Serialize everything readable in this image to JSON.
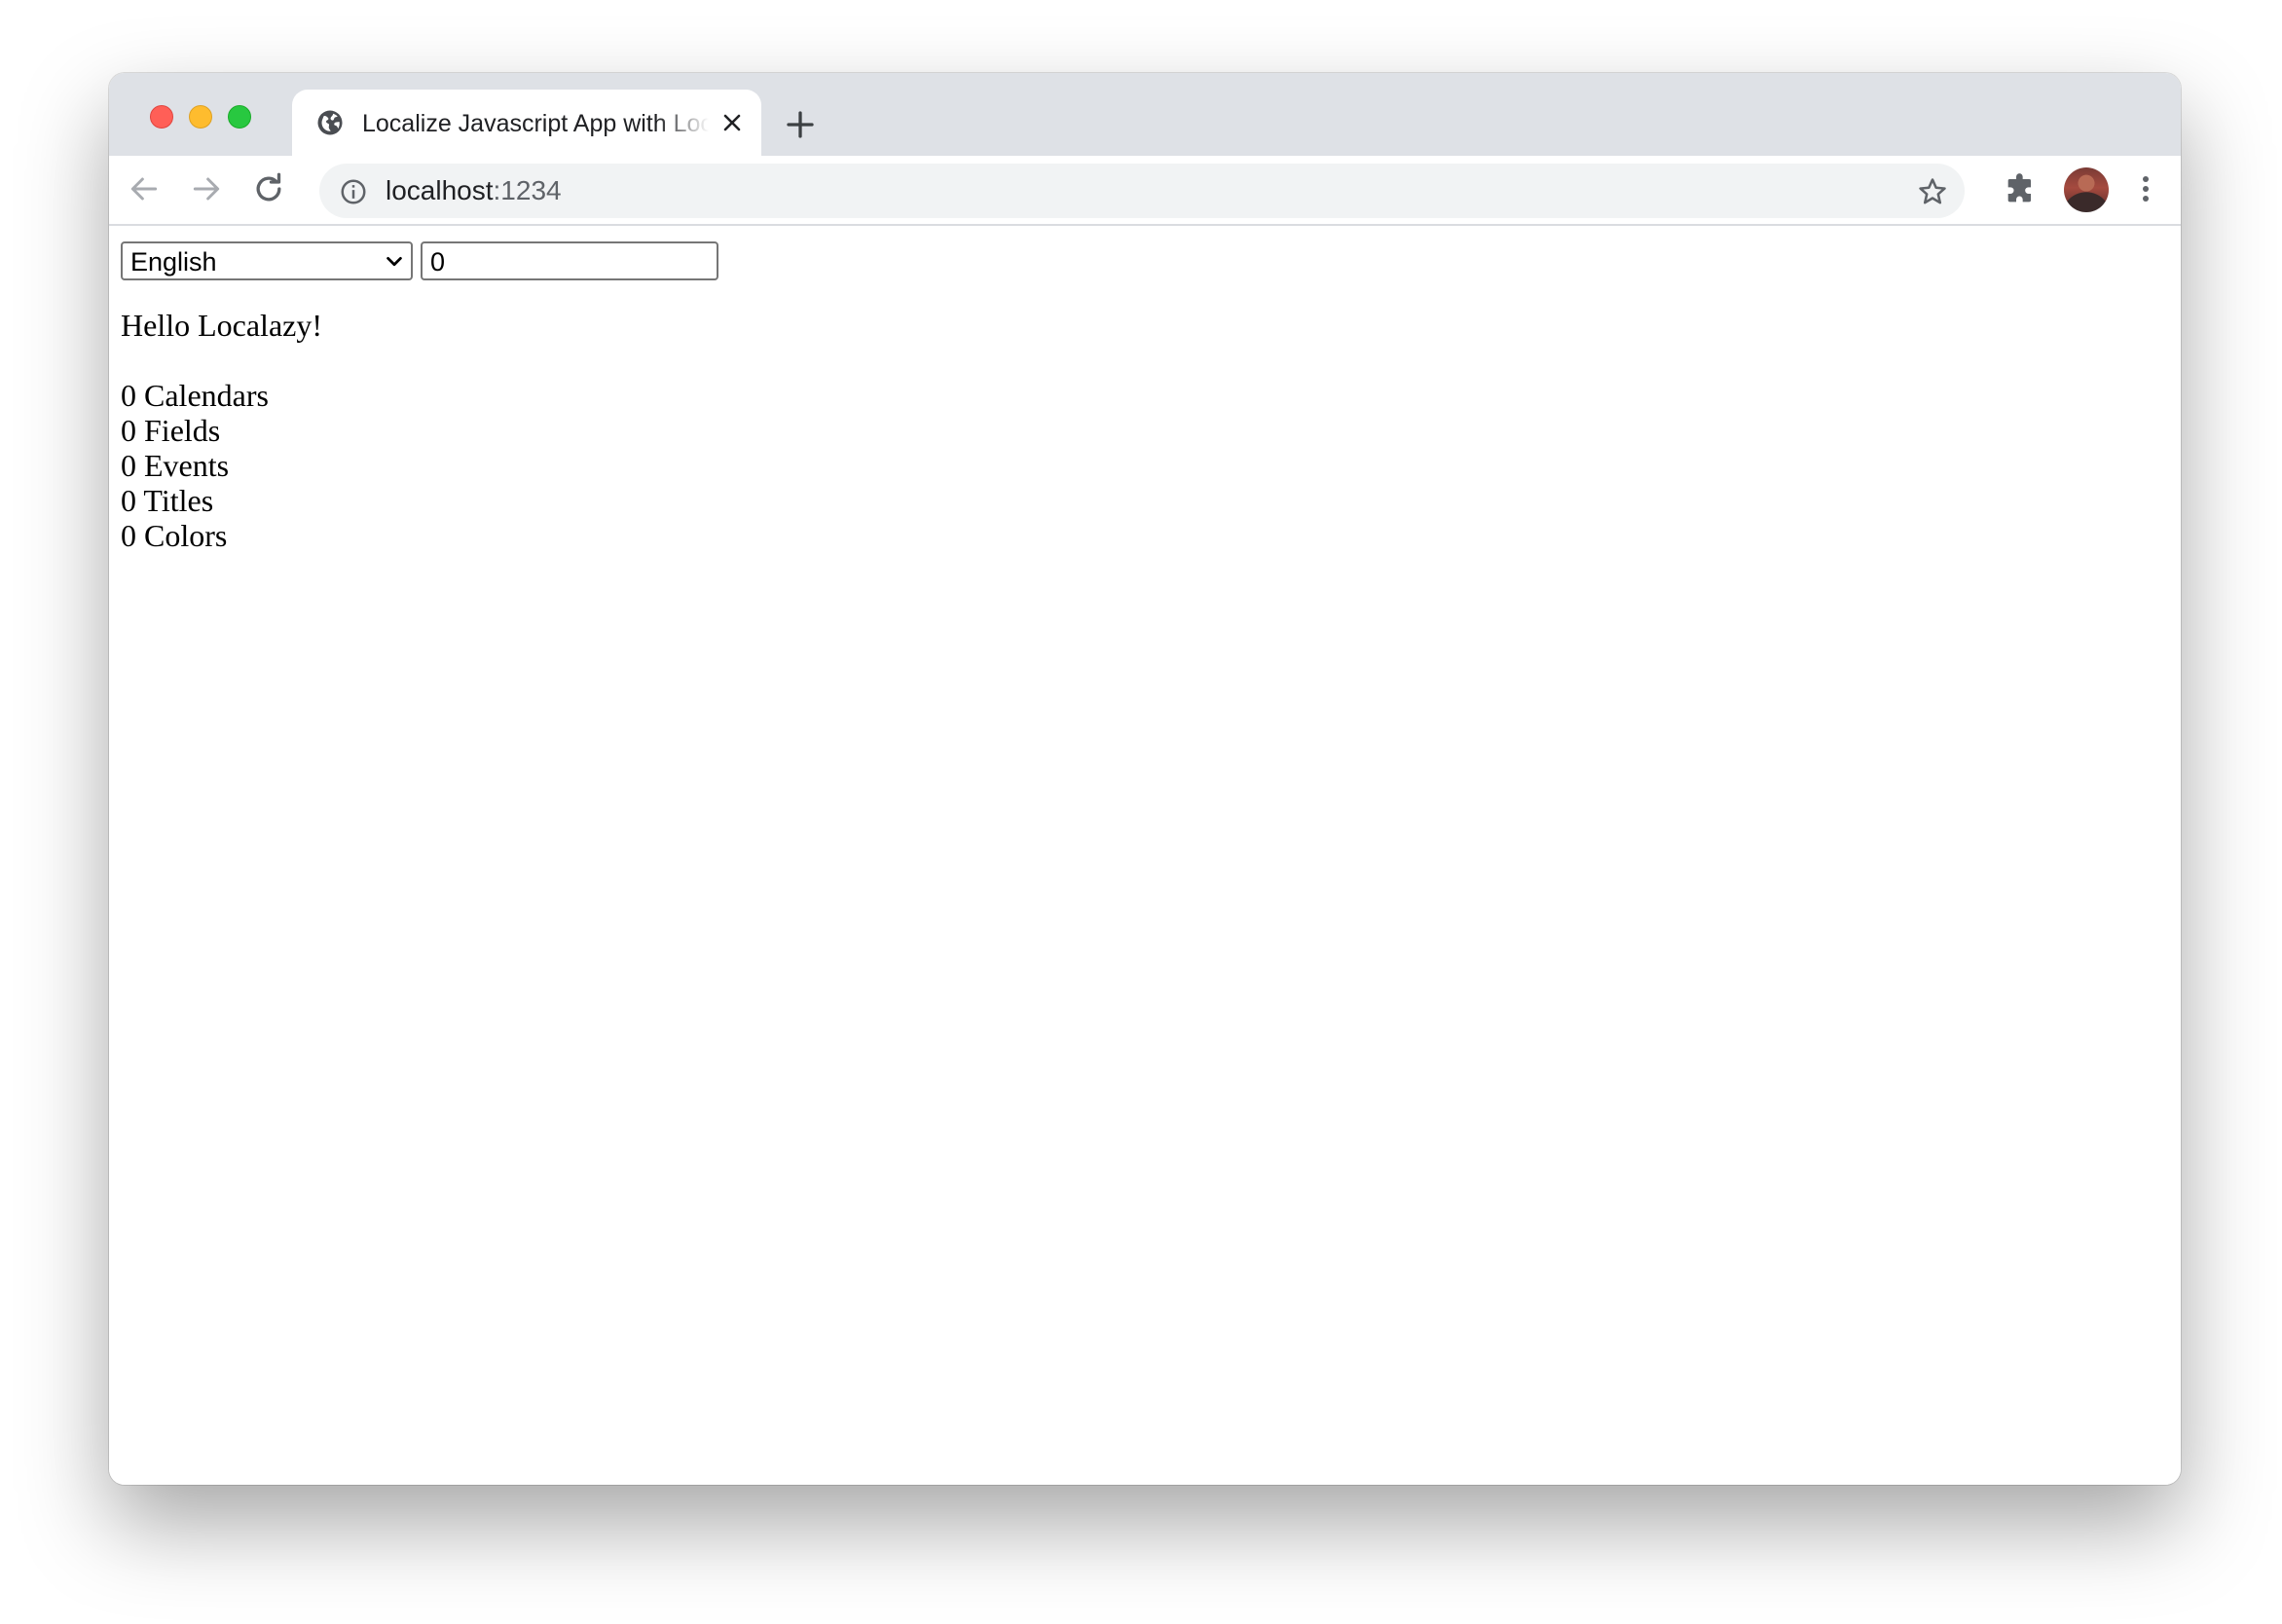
{
  "browser": {
    "tab": {
      "title": "Localize Javascript App with Localazy",
      "favicon": "globe-icon"
    },
    "address_bar": {
      "host": "localhost",
      "port": ":1234"
    }
  },
  "page": {
    "language_select": {
      "selected": "English"
    },
    "count_input": {
      "value": "0"
    },
    "greeting": "Hello Localazy!",
    "counts": [
      "0 Calendars",
      "0 Fields",
      "0 Events",
      "0 Titles",
      "0 Colors"
    ]
  },
  "colors": {
    "tab_strip": "#dee1e6",
    "close_red": "#ff5f57",
    "minimize_yellow": "#febc2e",
    "zoom_green": "#28c840",
    "omnibox_bg": "#f1f3f4",
    "icon_gray": "#5f6368"
  }
}
